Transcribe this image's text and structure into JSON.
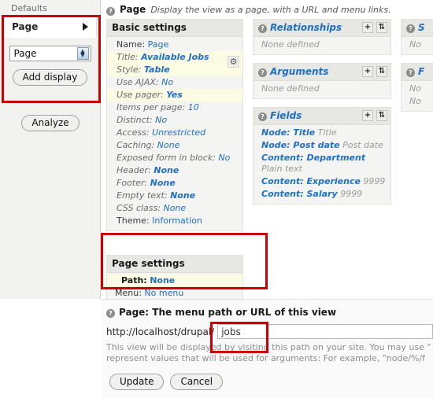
{
  "sidebar": {
    "defaults_label": "Defaults",
    "display_tab": "Page",
    "display_select_value": "Page",
    "add_display_button": "Add display",
    "analyze_button": "Analyze"
  },
  "main_header": {
    "help_glyph": "?",
    "title": "Page",
    "description": "Display the view as a page, with a URL and menu links."
  },
  "basic_settings": {
    "heading": "Basic settings",
    "rows": [
      {
        "label": "Name:",
        "value": "Page"
      },
      {
        "label": "Title:",
        "value": "Available Jobs"
      },
      {
        "label": "Style:",
        "value": "Table"
      },
      {
        "label": "Use AJAX:",
        "value": "No"
      },
      {
        "label": "Use pager:",
        "value": "Yes"
      },
      {
        "label": "Items per page:",
        "value": "10"
      },
      {
        "label": "Distinct:",
        "value": "No"
      },
      {
        "label": "Access:",
        "value": "Unrestricted"
      },
      {
        "label": "Caching:",
        "value": "None"
      },
      {
        "label": "Exposed form in block:",
        "value": "No"
      },
      {
        "label": "Header:",
        "value": "None"
      },
      {
        "label": "Footer:",
        "value": "None"
      },
      {
        "label": "Empty text:",
        "value": "None"
      },
      {
        "label": "CSS class:",
        "value": "None"
      },
      {
        "label": "Theme:",
        "value": "Information"
      }
    ],
    "style_gear_icon": "gear-icon"
  },
  "relationships": {
    "heading": "Relationships",
    "add_icon": "+",
    "rearrange_icon": "⇅",
    "empty_text": "None defined"
  },
  "arguments": {
    "heading": "Arguments",
    "add_icon": "+",
    "rearrange_icon": "⇅",
    "empty_text": "None defined"
  },
  "fields": {
    "heading": "Fields",
    "add_icon": "+",
    "rearrange_icon": "⇅",
    "items": [
      {
        "name": "Node: Title",
        "sub": "Title"
      },
      {
        "name": "Node: Post date",
        "sub": "Post date"
      },
      {
        "name": "Content: Department",
        "sub": "Plain text"
      },
      {
        "name": "Content: Experience",
        "sub": "9999"
      },
      {
        "name": "Content: Salary",
        "sub": "9999"
      }
    ]
  },
  "sort_criteria": {
    "heading": "S",
    "empty_text": "No"
  },
  "filters": {
    "heading": "F",
    "row1": "No",
    "row2": "No"
  },
  "page_settings": {
    "heading": "Page settings",
    "rows": [
      {
        "label": "Path:",
        "value": "None"
      },
      {
        "label": "Menu:",
        "value": "No menu"
      }
    ]
  },
  "path_form": {
    "title": "Page: The menu path or URL of this view",
    "url_prefix": "http://localhost/drupal/",
    "input_value": "jobs",
    "input_placeholder": "",
    "description_line1": "This view will be displayed by visiting this path on your site. You may use \"",
    "description_line2": "represent values that will be used for arguments: For example, \"node/%/f",
    "update_button": "Update",
    "cancel_button": "Cancel"
  },
  "colors": {
    "annotation_red": "#cc0000",
    "link_blue": "#1f6fc4",
    "highlight_yellow": "#fcfbe3",
    "panel_gray": "#f4f4f2"
  }
}
